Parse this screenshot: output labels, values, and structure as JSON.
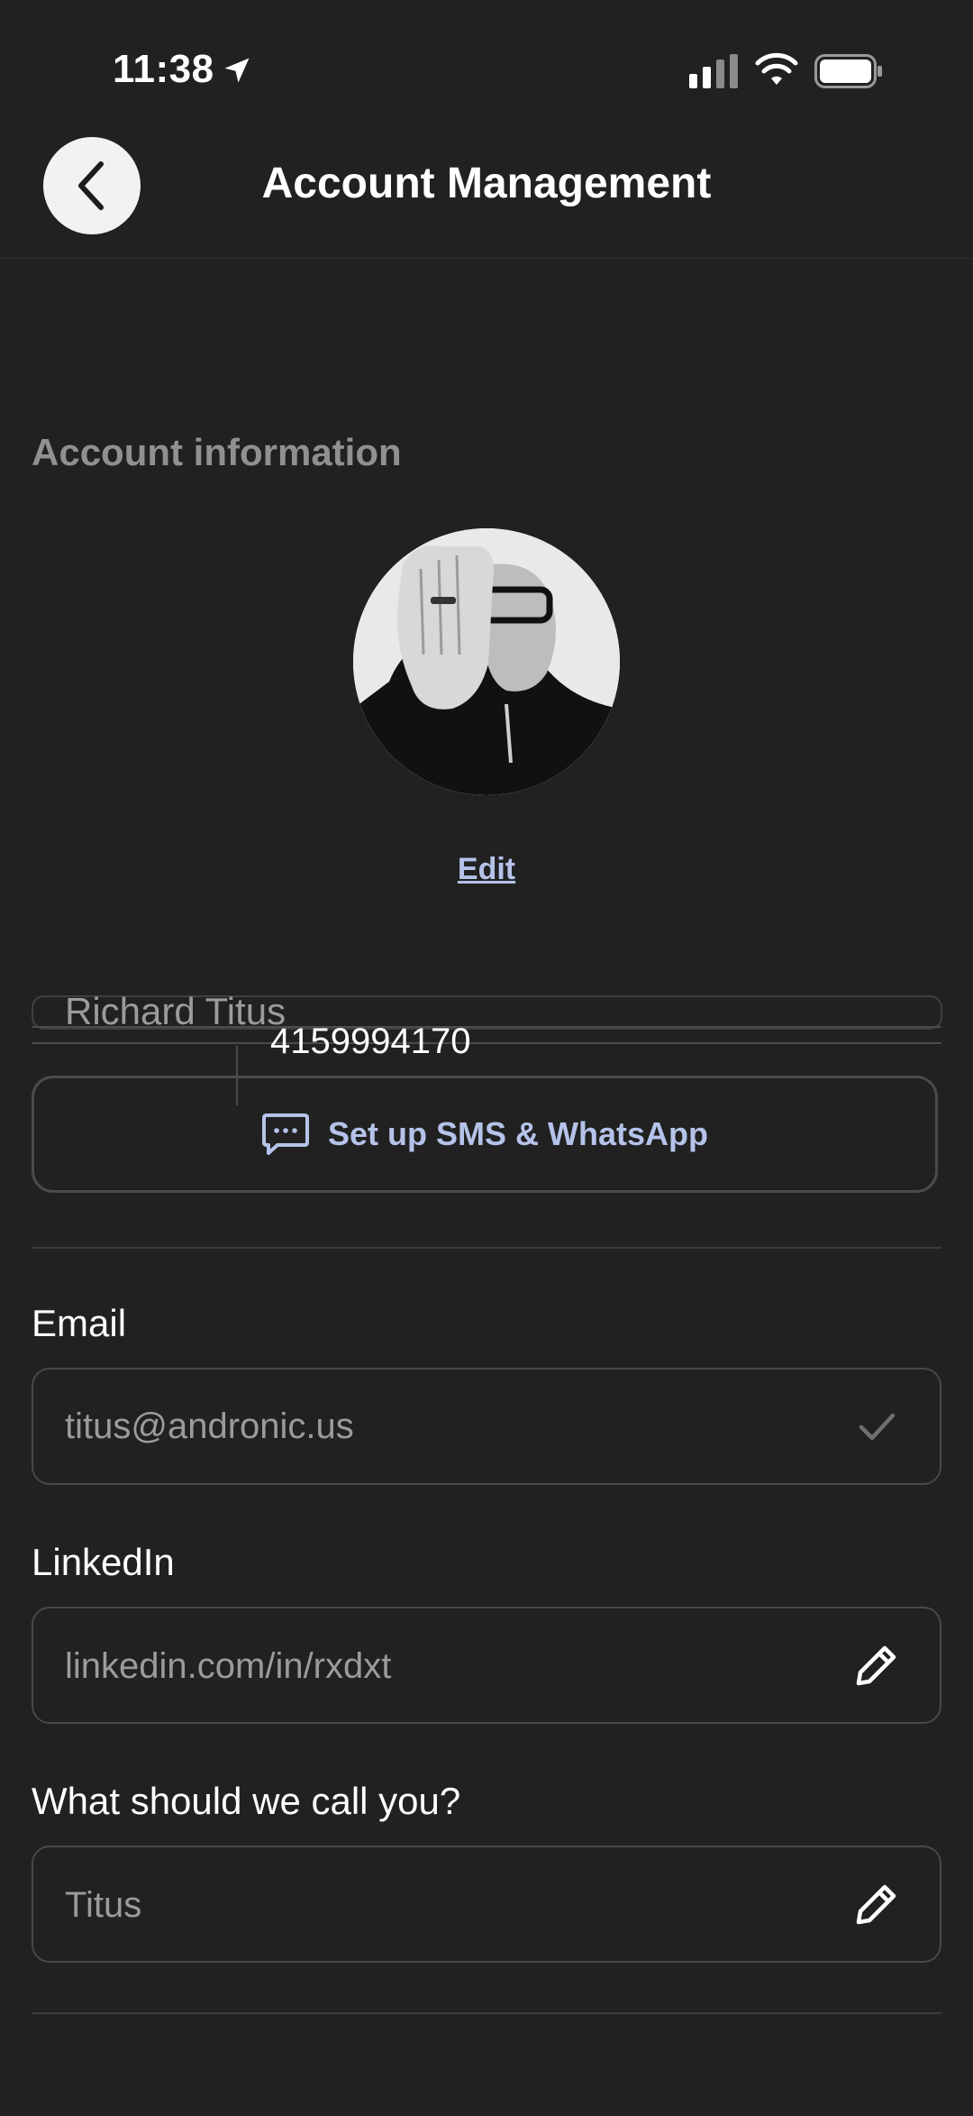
{
  "status_bar": {
    "time": "11:38"
  },
  "header": {
    "title": "Account Management"
  },
  "account": {
    "section_title": "Account information",
    "edit_label": "Edit",
    "name_value": "Richard Titus",
    "phone_value": "4159994170",
    "sms_button_label": "Set up SMS & WhatsApp"
  },
  "fields": {
    "email": {
      "label": "Email",
      "value": "titus@andronic.us"
    },
    "linkedin": {
      "label": "LinkedIn",
      "value": "linkedin.com/in/rxdxt"
    },
    "nickname": {
      "label": "What should we call you?",
      "value": "Titus"
    }
  },
  "colors": {
    "background": "#202120",
    "accent": "#b5c3ea",
    "muted": "#8e918e"
  },
  "icons": [
    "location-arrow-icon",
    "cellular-signal-icon",
    "wifi-icon",
    "battery-icon",
    "back-chevron-icon",
    "message-bubble-icon",
    "checkmark-icon",
    "pencil-icon"
  ]
}
